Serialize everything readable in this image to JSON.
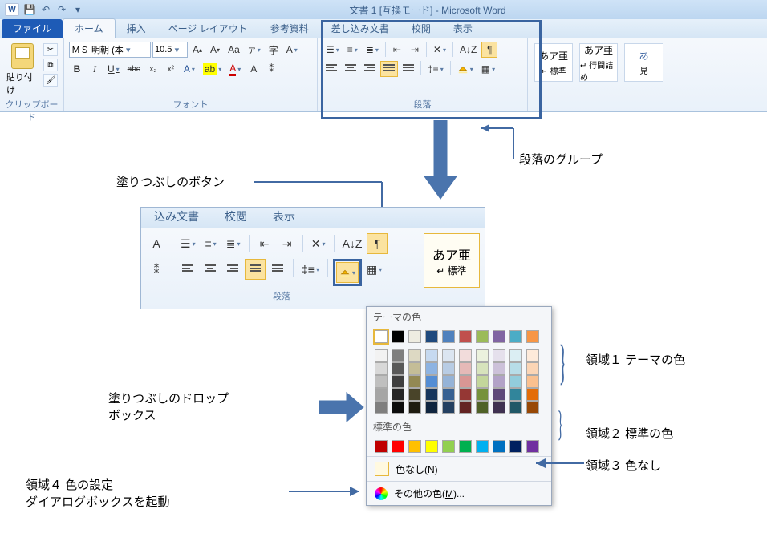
{
  "titlebar": {
    "doc_title": "文書 1 [互換モード] - Microsoft Word"
  },
  "tabs": {
    "file": "ファイル",
    "home": "ホーム",
    "insert": "挿入",
    "pagelayout": "ページ レイアウト",
    "references": "参考資料",
    "mailings": "差し込み文書",
    "review": "校閲",
    "view": "表示"
  },
  "clipboard": {
    "paste": "貼り付け",
    "group_label": "クリップボード"
  },
  "font": {
    "name": "ＭＳ 明朝 (本",
    "size": "10.5",
    "group_label": "フォント"
  },
  "para": {
    "group_label": "段落"
  },
  "styles": {
    "sample": "あア亜",
    "s1": "↵ 標準",
    "s2": "↵ 行間詰め",
    "s3_sample": "あ",
    "s3": "見"
  },
  "zoom_tabs": {
    "mailings": "込み文書",
    "review": "校閲",
    "view": "表示"
  },
  "zoom_styles": {
    "sample": "あア亜",
    "label": "↵ 標準"
  },
  "colorpop": {
    "theme_label": "テーマの色",
    "standard_label": "標準の色",
    "no_color": "色なし(N)",
    "other_colors": "その他の色(M)...",
    "theme_row1": [
      "#ffffff",
      "#000000",
      "#eeece1",
      "#1f497d",
      "#4f81bd",
      "#c0504d",
      "#9bbb59",
      "#8064a2",
      "#4bacc6",
      "#f79646"
    ],
    "theme_shades": [
      [
        "#f2f2f2",
        "#7f7f7f",
        "#ddd9c3",
        "#c6d9f0",
        "#dbe5f1",
        "#f2dcdb",
        "#ebf1dd",
        "#e5e0ec",
        "#dbeef3",
        "#fdeada"
      ],
      [
        "#d8d8d8",
        "#595959",
        "#c4bd97",
        "#8db3e2",
        "#b8cce4",
        "#e5b9b7",
        "#d7e3bc",
        "#ccc1d9",
        "#b7dde8",
        "#fbd5b5"
      ],
      [
        "#bfbfbf",
        "#3f3f3f",
        "#938953",
        "#548dd4",
        "#95b3d7",
        "#d99694",
        "#c3d69b",
        "#b2a2c7",
        "#92cddc",
        "#fac08f"
      ],
      [
        "#a5a5a5",
        "#262626",
        "#494429",
        "#17365d",
        "#366092",
        "#953734",
        "#76923c",
        "#5f497a",
        "#31859b",
        "#e36c09"
      ],
      [
        "#7f7f7f",
        "#0c0c0c",
        "#1d1b10",
        "#0f243e",
        "#244061",
        "#632423",
        "#4f6128",
        "#3f3151",
        "#205867",
        "#974806"
      ]
    ],
    "standard_colors": [
      "#c00000",
      "#ff0000",
      "#ffc000",
      "#ffff00",
      "#92d050",
      "#00b050",
      "#00b0f0",
      "#0070c0",
      "#002060",
      "#7030a0"
    ]
  },
  "annotations": {
    "fill_button": "塗りつぶしのボタン",
    "para_group": "段落のグループ",
    "fill_dropbox": "塗りつぶしのドロップ\nボックス",
    "region1": "領域１  テーマの色",
    "region2": "領域２  標準の色",
    "region3": "領域３  色なし",
    "region4": "領域４  色の設定\nダイアログボックスを起動"
  }
}
